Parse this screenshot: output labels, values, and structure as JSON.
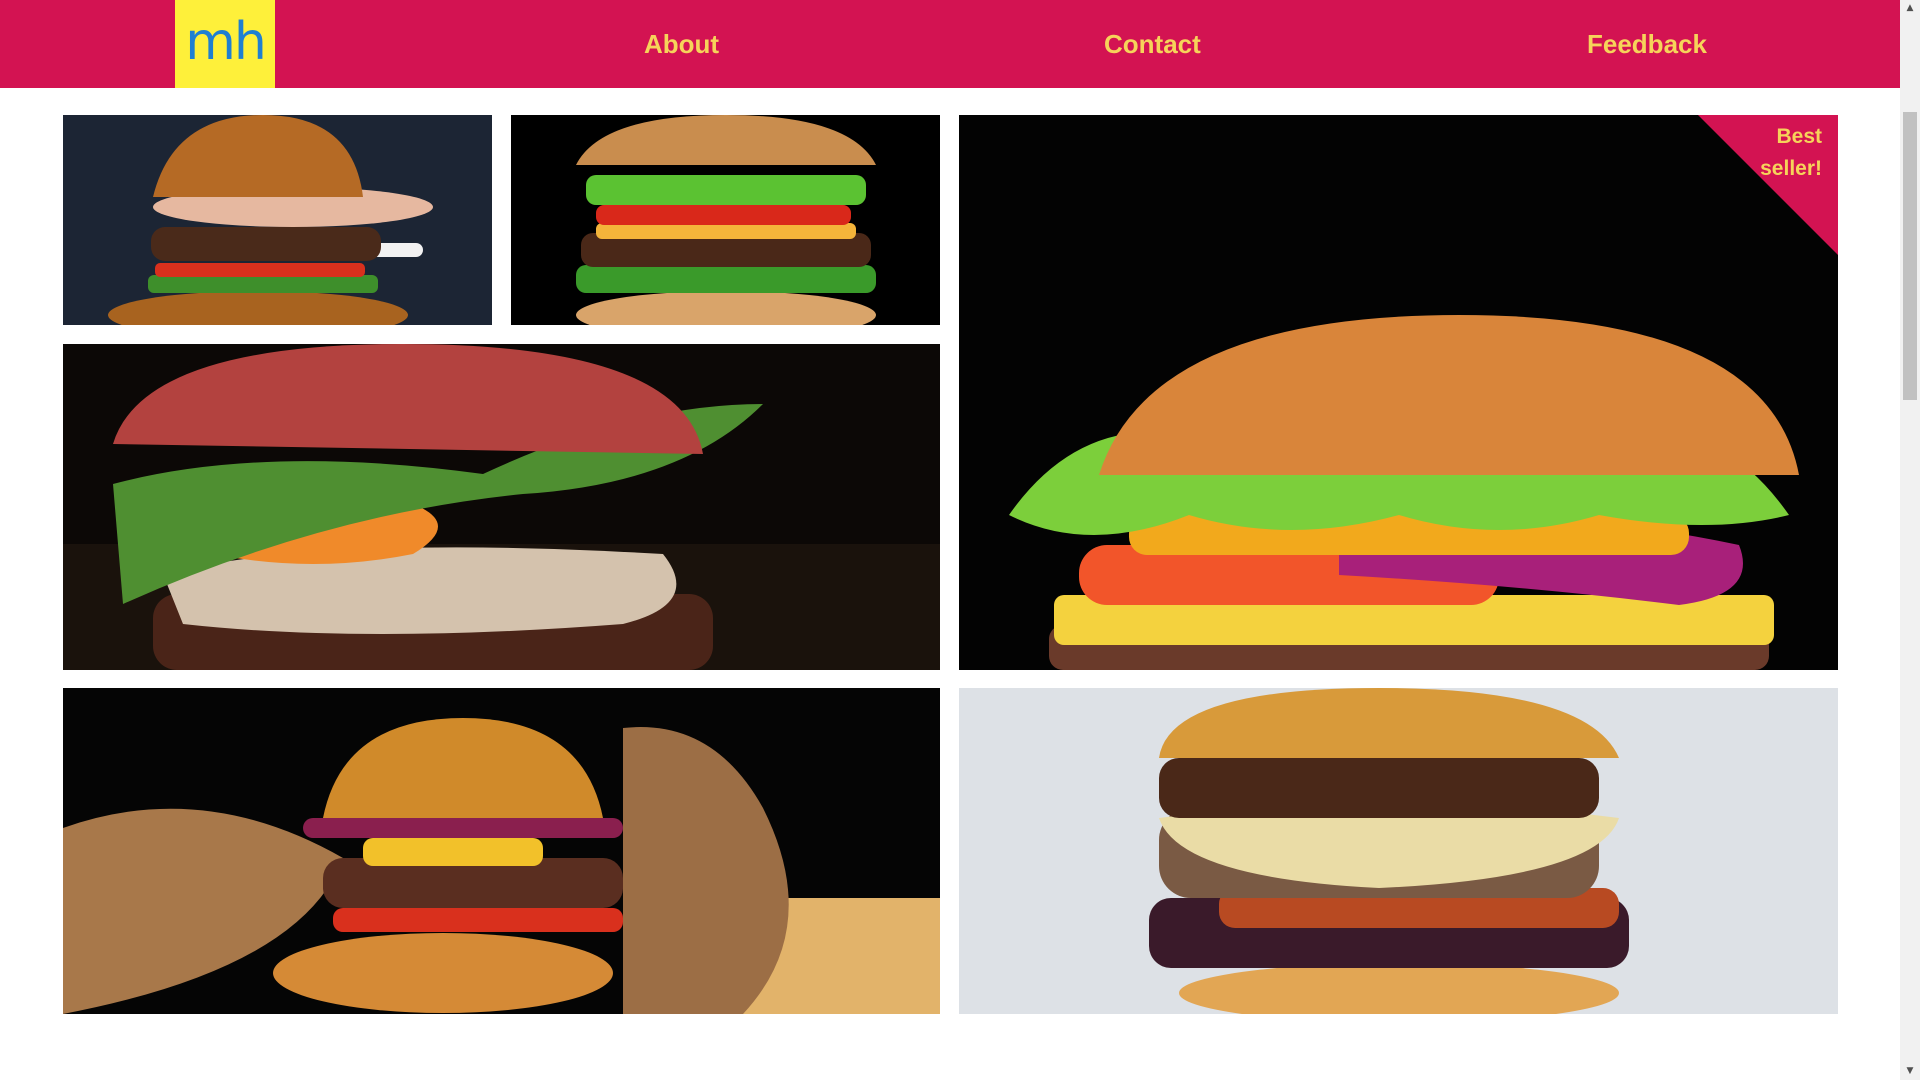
{
  "header": {
    "logo_text": "mh",
    "nav": {
      "about": "About",
      "contact": "Contact",
      "feedback": "Feedback"
    }
  },
  "gallery": {
    "badge": "Best seller!"
  },
  "colors": {
    "brand": "#d31352",
    "logo_bg": "#fef03a",
    "logo_text": "#1f7fd1",
    "nav_text": "#f6d35a"
  }
}
